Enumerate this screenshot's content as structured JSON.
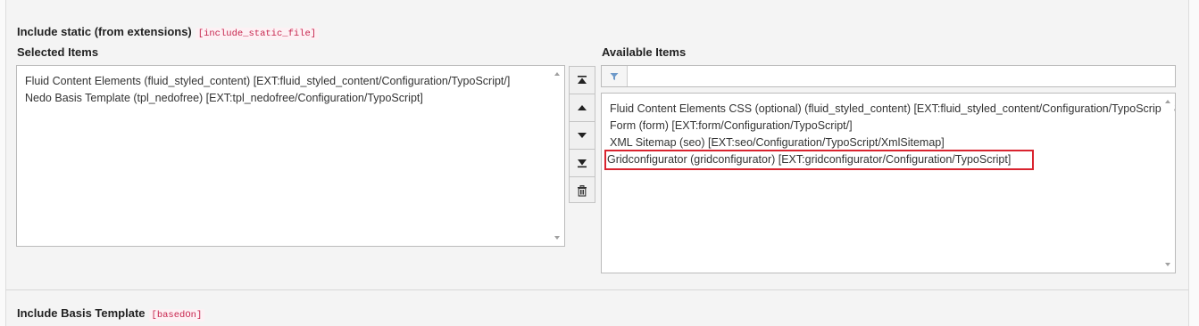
{
  "field": {
    "title": "Include static (from extensions)",
    "code": "[include_static_file]"
  },
  "selected": {
    "label": "Selected Items",
    "items": [
      "Fluid Content Elements (fluid_styled_content) [EXT:fluid_styled_content/Configuration/TypoScript/]",
      "Nedo Basis Template (tpl_nedofree) [EXT:tpl_nedofree/Configuration/TypoScript]"
    ]
  },
  "available": {
    "label": "Available Items",
    "filter_value": "",
    "items": [
      "Fluid Content Elements CSS (optional) (fluid_styled_content) [EXT:fluid_styled_content/Configuration/TypoScript/Styling/]",
      "Form (form) [EXT:form/Configuration/TypoScript/]",
      "XML Sitemap (seo) [EXT:seo/Configuration/TypoScript/XmlSitemap]",
      "Gridconfigurator (gridconfigurator) [EXT:gridconfigurator/Configuration/TypoScript]"
    ],
    "highlighted_index": 3,
    "highlight_color": "#d9242f"
  },
  "buttons": [
    "move-to-top",
    "move-up",
    "move-down",
    "move-to-bottom",
    "remove"
  ],
  "next_field": {
    "title": "Include Basis Template",
    "code": "[basedOn]"
  }
}
